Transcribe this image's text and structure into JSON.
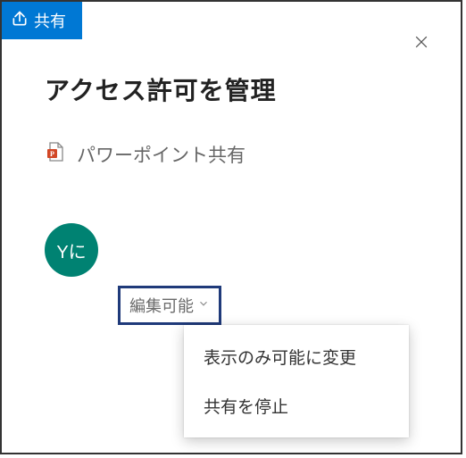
{
  "ribbon": {
    "share_label": "共有"
  },
  "dialog": {
    "title": "アクセス許可を管理",
    "file_name": "パワーポイント共有",
    "avatar_initials": "Yに",
    "permission_label": "編集可能",
    "menu": {
      "change_to_view": "表示のみ可能に変更",
      "stop_sharing": "共有を停止"
    }
  },
  "colors": {
    "primary": "#0078d4",
    "avatar_bg": "#008272",
    "highlight_border": "#1f3a7a"
  }
}
